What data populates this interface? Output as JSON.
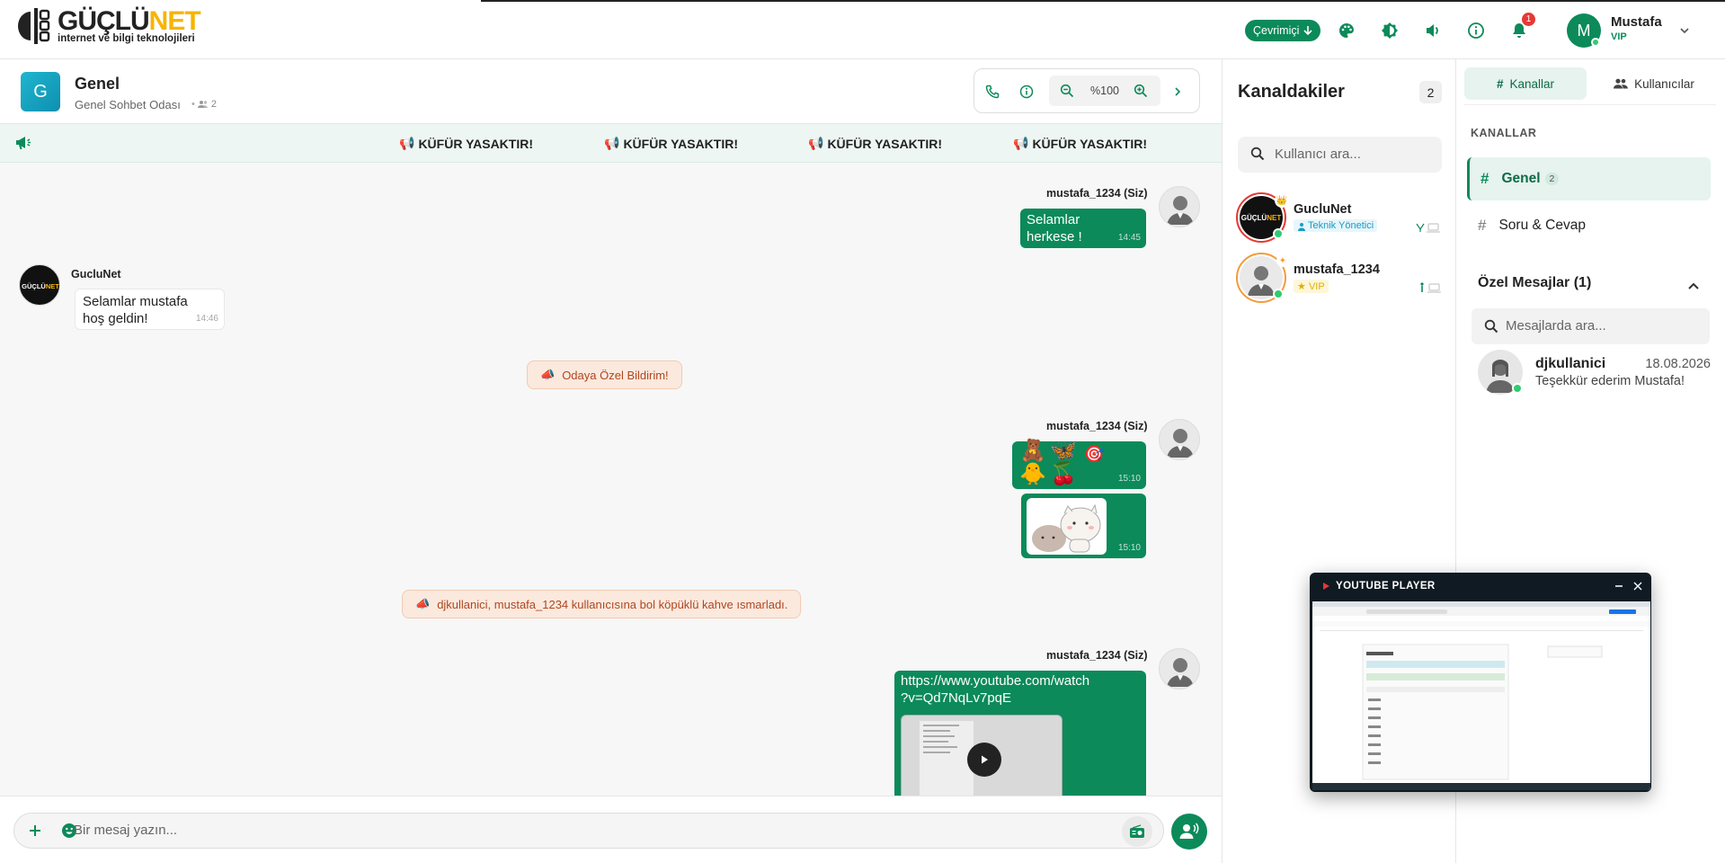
{
  "header": {
    "logo_brand_main": "GÜÇLÜ",
    "logo_brand_accent": "NET",
    "logo_tagline": "internet ve bilgi teknolojileri",
    "status_label": "Çevrimiçi",
    "notification_count": "1",
    "user_initial": "M",
    "user_name": "Mustafa",
    "user_role": "VIP"
  },
  "room": {
    "icon_letter": "G",
    "title": "Genel",
    "subtitle": "Genel Sohbet Odası",
    "member_count": "2",
    "zoom": "%100"
  },
  "announcement": {
    "items": [
      "KÜFÜR YASAKTIR!",
      "KÜFÜR YASAKTIR!",
      "KÜFÜR YASAKTIR!",
      "KÜFÜR YASAKTIR!"
    ]
  },
  "messages": {
    "m1": {
      "sender": "mustafa_1234 (Siz)",
      "line1": "Selamlar",
      "line2": "herkese !",
      "time": "14:45"
    },
    "m2": {
      "sender": "GucluNet",
      "line1": "Selamlar mustafa",
      "line2": "hoş geldin!",
      "time": "14:46"
    },
    "sys1": "Odaya Özel Bildirim!",
    "m3": {
      "sender": "mustafa_1234 (Siz)",
      "emojis": [
        "🧸",
        "🦋",
        "🎯",
        "🐥",
        "🍒"
      ],
      "time": "15:10"
    },
    "m4": {
      "time": "15:10"
    },
    "sys2": "djkullanici, mustafa_1234 kullanıcısına bol köpüklü kahve ısmarladı.",
    "m5": {
      "sender": "mustafa_1234 (Siz)",
      "line1": "https://www.youtube.com/watch",
      "line2": "?v=Qd7NqLv7pqE"
    }
  },
  "input": {
    "placeholder": "Bir mesaj yazın..."
  },
  "users_panel": {
    "title": "Kanaldakiler",
    "count": "2",
    "search_placeholder": "Kullanıcı ara...",
    "users": [
      {
        "name": "GucluNet",
        "role": "Teknik Yönetici"
      },
      {
        "name": "mustafa_1234",
        "role": "VIP"
      }
    ]
  },
  "channels_panel": {
    "tab_channels": "Kanallar",
    "tab_users": "Kullanıcılar",
    "section_label": "KANALLAR",
    "channels": [
      {
        "name": "Genel",
        "count": "2"
      },
      {
        "name": "Soru & Cevap"
      }
    ],
    "pm_header": "Özel Mesajlar (1)",
    "pm_search_placeholder": "Mesajlarda ara...",
    "pm": {
      "name": "djkullanici",
      "date": "18.08.2026",
      "text": "Teşekkür ederim Mustafa!"
    }
  },
  "youtube_player": {
    "title": "YOUTUBE PLAYER"
  },
  "colors": {
    "accent": "#0c8a5a",
    "logo_accent": "#f7b400",
    "notification": "#e53935",
    "system_message_bg": "#fbe9de"
  }
}
